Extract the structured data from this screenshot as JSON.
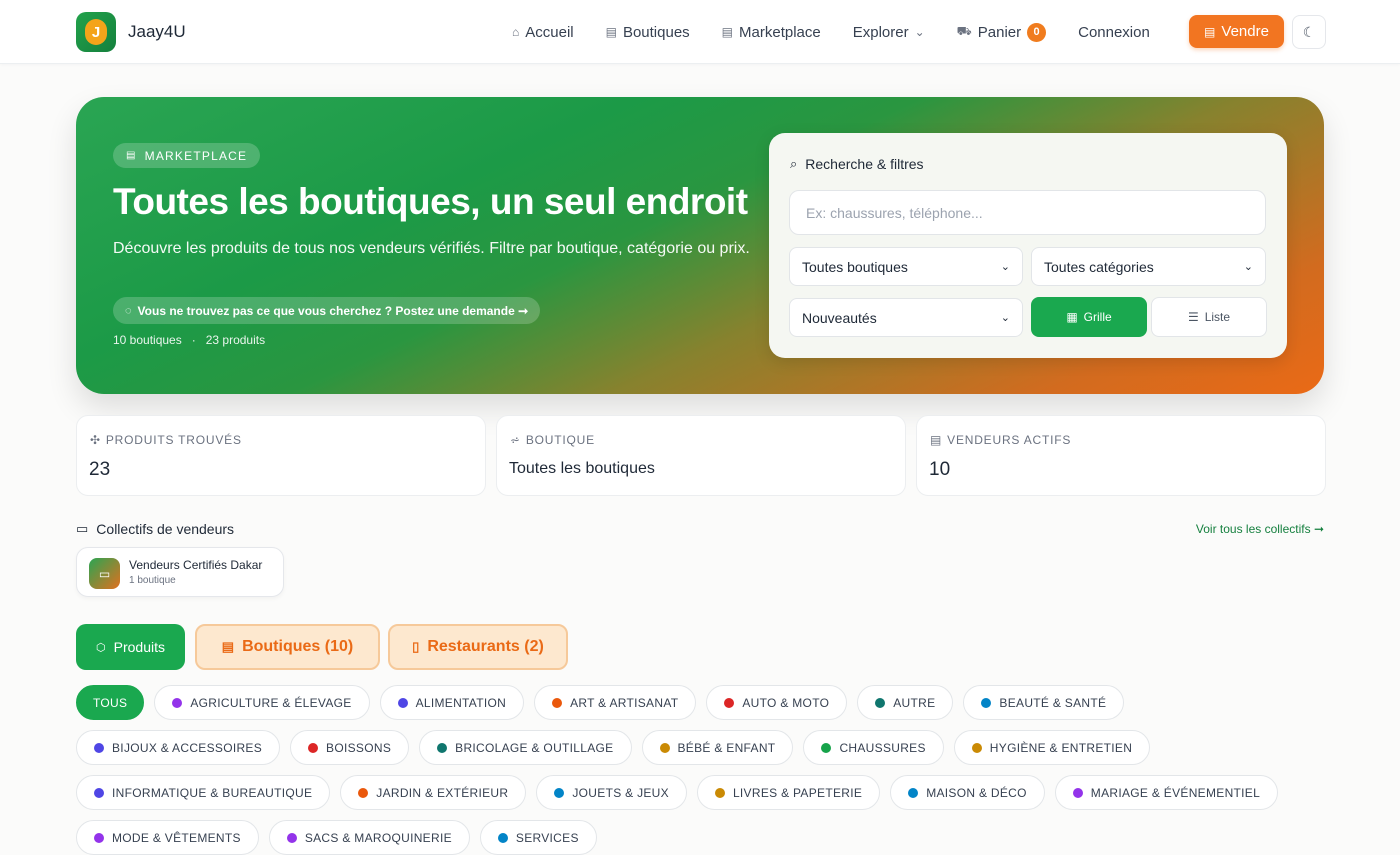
{
  "nav": {
    "brand": "Jaay4U",
    "logo_letter": "J",
    "links": [
      "Accueil",
      "Boutiques",
      "Marketplace",
      "Explorer",
      "Panier"
    ],
    "cart_count": "0",
    "login": "Connexion",
    "sell": "Vendre",
    "icons": [
      "home-icon",
      "store-icon",
      "store-icon",
      "chevron-down-icon",
      "cart-icon",
      "moon-icon"
    ]
  },
  "hero": {
    "badge": "MARKETPLACE",
    "title": "Toutes les boutiques, un seul endroit",
    "description": "Découvre les produits de tous nos vendeurs vérifiés. Filtre par boutique, catégorie ou prix.",
    "cta": "Vous ne trouvez pas ce que vous cherchez ? Postez une demande ➞",
    "stats_shops": "10 boutiques",
    "stats_separator": "·",
    "stats_products": "23 produits"
  },
  "filters": {
    "title": "Recherche & filtres",
    "search_placeholder": "Ex: chaussures, téléphone...",
    "shop_select": "Toutes boutiques",
    "category_select": "Toutes catégories",
    "sort_select": "Nouveautés",
    "grid_label": "Grille",
    "list_label": "Liste"
  },
  "stats": {
    "products_label": "PRODUITS TROUVÉS",
    "products_value": "23",
    "shop_label": "BOUTIQUE",
    "shop_value": "Toutes les boutiques",
    "vendors_label": "VENDEURS ACTIFS",
    "vendors_value": "10"
  },
  "collectives": {
    "title": "Collectifs de vendeurs",
    "see_all": "Voir tous les collectifs ➞",
    "card_name": "Vendeurs Certifiés Dakar",
    "card_count": "1 boutique"
  },
  "tabs": {
    "products": "Produits",
    "shops": "Boutiques (10)",
    "restaurants": "Restaurants (2)"
  },
  "categories": {
    "all": "TOUS",
    "items": [
      {
        "label": "AGRICULTURE & ÉLEVAGE",
        "color": "#9333ea"
      },
      {
        "label": "ALIMENTATION",
        "color": "#4f46e5"
      },
      {
        "label": "ART & ARTISANAT",
        "color": "#ea580c"
      },
      {
        "label": "AUTO & MOTO",
        "color": "#dc2626"
      },
      {
        "label": "AUTRE",
        "color": "#0f766e"
      },
      {
        "label": "BEAUTÉ & SANTÉ",
        "color": "#0284c7"
      },
      {
        "label": "BIJOUX & ACCESSOIRES",
        "color": "#4f46e5"
      },
      {
        "label": "BOISSONS",
        "color": "#dc2626"
      },
      {
        "label": "BRICOLAGE & OUTILLAGE",
        "color": "#0f766e"
      },
      {
        "label": "BÉBÉ & ENFANT",
        "color": "#ca8a04"
      },
      {
        "label": "CHAUSSURES",
        "color": "#16a34a"
      },
      {
        "label": "HYGIÈNE & ENTRETIEN",
        "color": "#ca8a04"
      },
      {
        "label": "INFORMATIQUE & BUREAUTIQUE",
        "color": "#4f46e5"
      },
      {
        "label": "JARDIN & EXTÉRIEUR",
        "color": "#ea580c"
      },
      {
        "label": "JOUETS & JEUX",
        "color": "#0284c7"
      },
      {
        "label": "LIVRES & PAPETERIE",
        "color": "#ca8a04"
      },
      {
        "label": "MAISON & DÉCO",
        "color": "#0284c7"
      },
      {
        "label": "MARIAGE & ÉVÉNEMENTIEL",
        "color": "#9333ea"
      },
      {
        "label": "MODE & VÊTEMENTS",
        "color": "#9333ea"
      },
      {
        "label": "SACS & MAROQUINERIE",
        "color": "#9333ea"
      },
      {
        "label": "SERVICES",
        "color": "#0284c7"
      }
    ]
  },
  "colors": {
    "primary_green": "#1aa84f",
    "accent_orange": "#f27521"
  }
}
